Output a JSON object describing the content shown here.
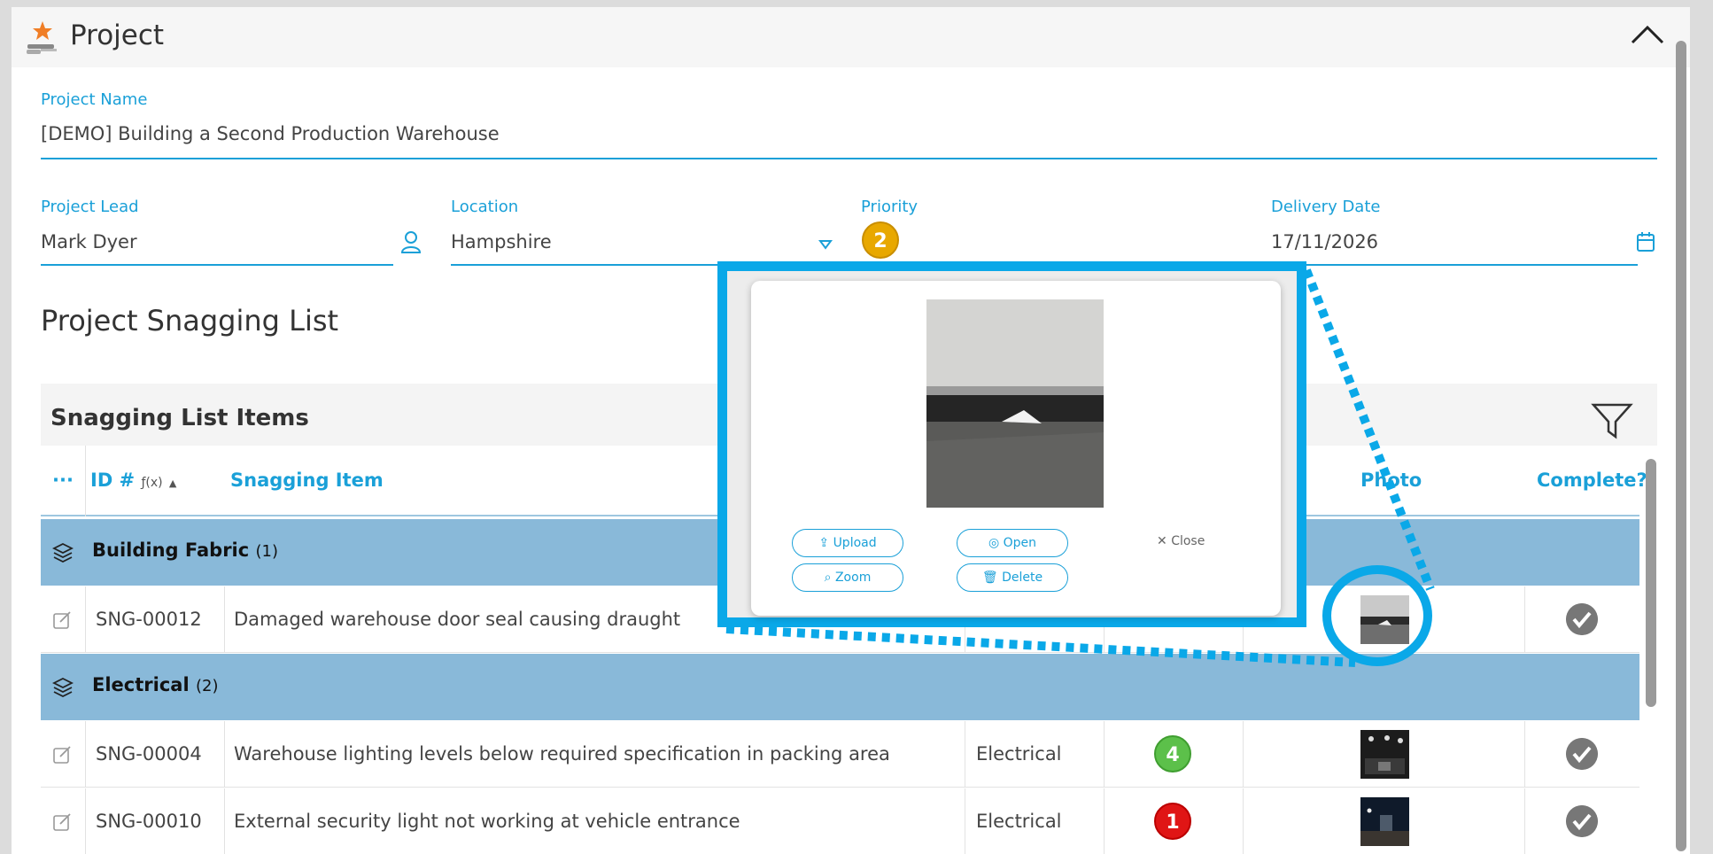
{
  "header": {
    "title": "Project",
    "logo_icon": "star-hand-icon",
    "collapse_icon": "chevron-up-icon"
  },
  "form": {
    "project_name": {
      "label": "Project Name",
      "value": "[DEMO] Building a Second Production Warehouse"
    },
    "project_lead": {
      "label": "Project Lead",
      "value": "Mark Dyer",
      "icon": "person-icon"
    },
    "location": {
      "label": "Location",
      "value": "Hampshire",
      "icon": "dropdown-caret-icon"
    },
    "priority": {
      "label": "Priority",
      "value": "2"
    },
    "delivery_date": {
      "label": "Delivery Date",
      "value": "17/11/2026",
      "icon": "calendar-icon"
    }
  },
  "section_title": "Project Snagging List",
  "grid": {
    "title": "Snagging List Items",
    "columns": {
      "menu": "···",
      "id": "ID #",
      "id_suffix": "ƒ(x)",
      "item": "Snagging Item",
      "photo": "Photo",
      "complete": "Complete?"
    },
    "groups": [
      {
        "label": "Building Fabric",
        "count": "(1)",
        "rows": [
          {
            "id": "SNG-00012",
            "item": "Damaged warehouse door seal causing draught",
            "category": "",
            "priority": ""
          }
        ]
      },
      {
        "label": "Electrical",
        "count": "(2)",
        "rows": [
          {
            "id": "SNG-00004",
            "item": "Warehouse lighting levels below required specification in packing area",
            "category": "Electrical",
            "priority": "4"
          },
          {
            "id": "SNG-00010",
            "item": "External security light not working at vehicle entrance",
            "category": "Electrical",
            "priority": "1"
          }
        ]
      }
    ]
  },
  "popup": {
    "upload": "Upload",
    "open": "Open",
    "close": "Close",
    "zoom": "Zoom",
    "delete": "Delete"
  },
  "colors": {
    "accent": "#1aa0d8",
    "group_bg": "#89b9d9",
    "callout": "#0aa8e8",
    "priority_2": "#e8a800",
    "priority_4": "#5cc04a",
    "priority_1": "#e01515"
  }
}
